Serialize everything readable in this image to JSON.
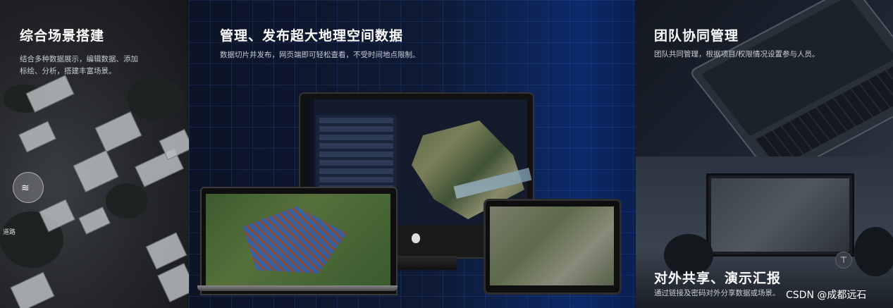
{
  "panels": {
    "integrated": {
      "title": "综合场景搭建",
      "description_line1": "结合多种数据展示，编辑数据、添加",
      "description_line2": "标绘、分析，搭建丰富场景。",
      "map_labels": [
        "道路"
      ]
    },
    "publish": {
      "title": "管理、发布超大地理空间数据",
      "description": "数据切片并发布，网页端即可轻松查看，不受时间地点限制。"
    },
    "team": {
      "title": "团队协同管理",
      "description": "团队共同管理，根据项目/权限情况设置参与人员。"
    },
    "share": {
      "title": "对外共享、演示汇报",
      "description": "通过链接及密码对外分享数据或场景。"
    }
  },
  "scroll_top_icon": "arrow-up-to-top-icon",
  "scroll_top_glyph": "⊤",
  "watermark": "CSDN @成都远石",
  "colors": {
    "center_accent": "#0d2a6b",
    "grid_line": "#3c6ec8"
  }
}
